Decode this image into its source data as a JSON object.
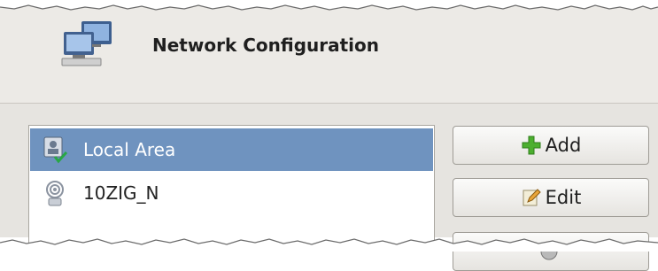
{
  "window": {
    "title": "Network Configuration"
  },
  "connections": [
    {
      "label": "Local Area",
      "icon": "wired-connected-icon",
      "selected": true
    },
    {
      "label": "10ZIG_N",
      "icon": "wireless-icon",
      "selected": false
    }
  ],
  "buttons": {
    "add_label": "Add",
    "edit_label": "Edit"
  },
  "colors": {
    "selection": "#6f93bf",
    "header_bg": "#eceae6",
    "panel_bg": "#e6e4e0"
  }
}
